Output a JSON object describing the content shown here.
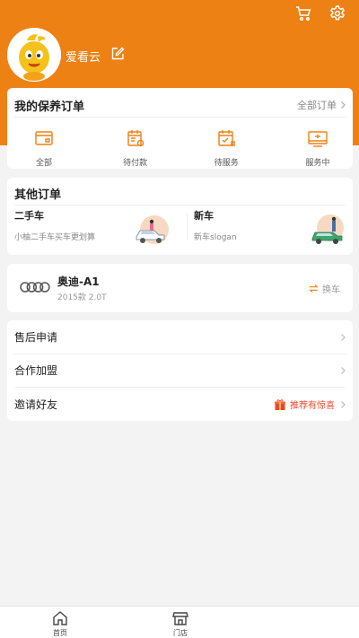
{
  "header": {
    "username": "爱看云"
  },
  "maintenance_orders": {
    "title": "我的保养订单",
    "all_orders_link": "全部订单",
    "items": [
      {
        "label": "全部",
        "icon": "wallet-icon"
      },
      {
        "label": "待付款",
        "icon": "calendar-pay-icon"
      },
      {
        "label": "待服务",
        "icon": "calendar-service-icon"
      },
      {
        "label": "服务中",
        "icon": "in-service-icon"
      }
    ]
  },
  "other_orders": {
    "title": "其他订单",
    "used_car": {
      "title": "二手车",
      "subtitle": "小柚二手车买车更划算"
    },
    "new_car": {
      "title": "新车",
      "subtitle": "新车slogan"
    }
  },
  "car": {
    "name": "奥迪-A1",
    "year": "2015款 2.0T",
    "swap_label": "换车"
  },
  "menu": {
    "after_sales": "售后申请",
    "franchise": "合作加盟",
    "invite": "邀请好友",
    "invite_promo": "推荐有惊喜"
  },
  "bottom_nav": {
    "home": "首页",
    "store": "门店"
  },
  "colors": {
    "brand": "#ee8114",
    "invite_red": "#e84a2c"
  }
}
